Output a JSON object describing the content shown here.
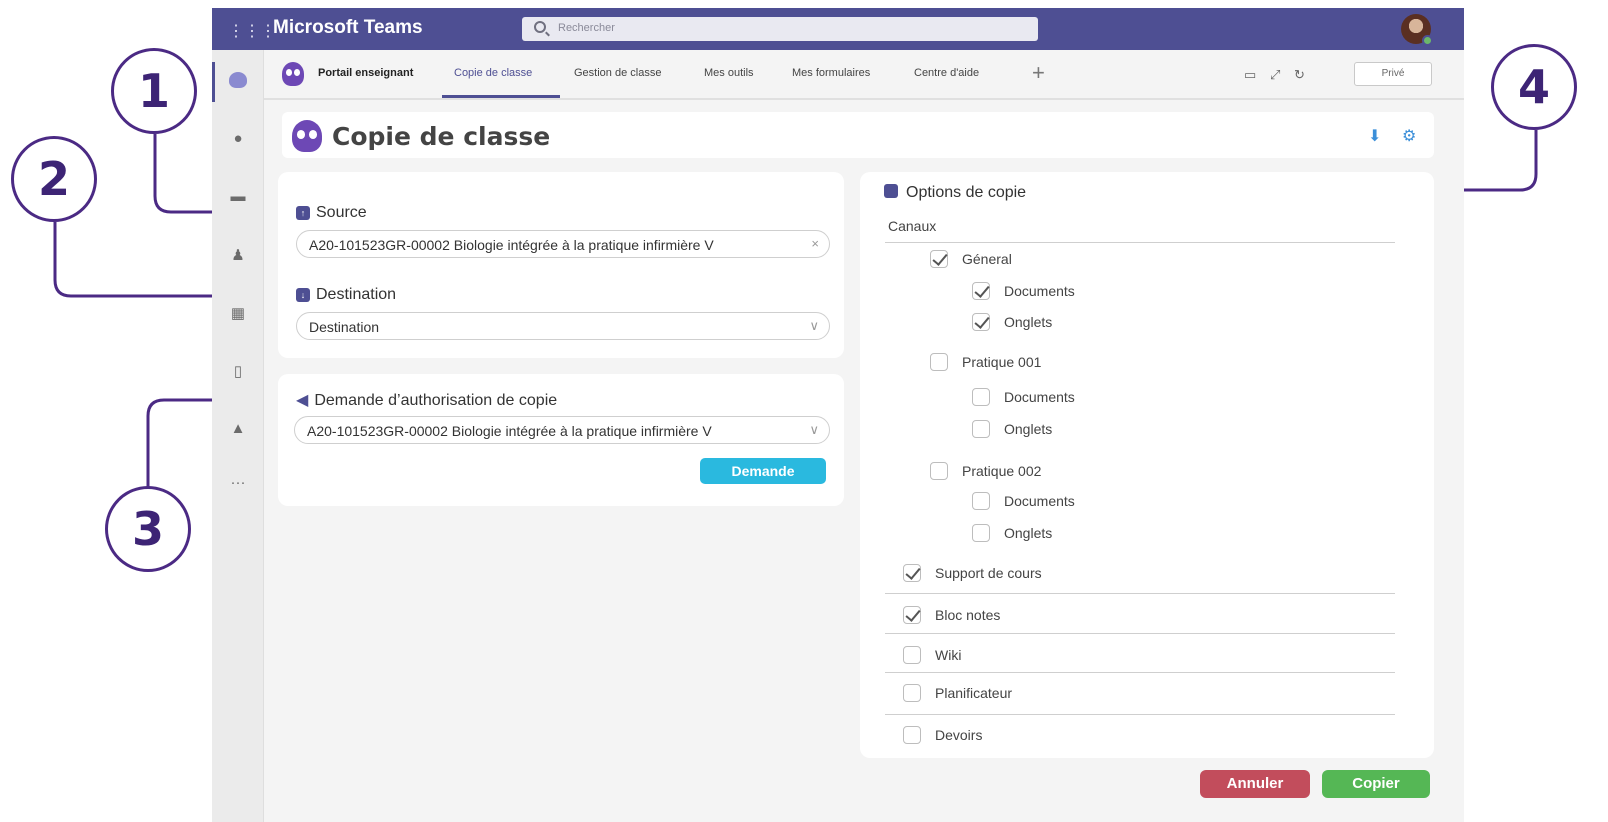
{
  "callouts": [
    "1",
    "2",
    "3",
    "4"
  ],
  "titlebar": {
    "app_name": "Microsoft Teams",
    "search_placeholder": "Rechercher"
  },
  "tabs": [
    {
      "label": "Portail enseignant",
      "active": false
    },
    {
      "label": "Copie de classe",
      "active": true
    },
    {
      "label": "Gestion de classe",
      "active": false
    },
    {
      "label": "Mes outils",
      "active": false
    },
    {
      "label": "Mes formulaires",
      "active": false
    },
    {
      "label": "Centre d'aide",
      "active": false
    }
  ],
  "tabbar": {
    "add_label": "+",
    "private_label": "Privé"
  },
  "page": {
    "title": "Copie de classe"
  },
  "source": {
    "label": "Source",
    "value": "A20-101523GR-00002 Biologie intégrée à la pratique infirmière V",
    "clear": "×"
  },
  "destination": {
    "label": "Destination",
    "value": "Destination"
  },
  "request": {
    "label": "Demande d’authorisation de copie",
    "value": "A20-101523GR-00002 Biologie intégrée à la pratique infirmière V",
    "button": "Demande"
  },
  "options": {
    "title": "Options de copie",
    "channels_header": "Canaux",
    "items": [
      {
        "label": "Géneral",
        "checked": true
      },
      {
        "label": "Documents",
        "checked": true
      },
      {
        "label": "Onglets",
        "checked": true
      },
      {
        "label": "Pratique 001",
        "checked": false
      },
      {
        "label": "Documents",
        "checked": false
      },
      {
        "label": "Onglets",
        "checked": false
      },
      {
        "label": "Pratique 002",
        "checked": false
      },
      {
        "label": "Documents",
        "checked": false
      },
      {
        "label": "Onglets",
        "checked": false
      },
      {
        "label": "Support de cours",
        "checked": true
      },
      {
        "label": "Bloc notes",
        "checked": true
      },
      {
        "label": "Wiki",
        "checked": false
      },
      {
        "label": "Planificateur",
        "checked": false
      },
      {
        "label": "Devoirs",
        "checked": false
      }
    ]
  },
  "footer": {
    "cancel": "Annuler",
    "copy": "Copier"
  },
  "colors": {
    "teams_purple": "#4e4f93",
    "callout": "#4b2a84",
    "request_button": "#2ab9df",
    "cancel": "#c24d5c",
    "copy": "#55b755"
  },
  "icons": [
    "apps-grid-icon",
    "search-icon",
    "bell-icon",
    "chat-icon",
    "teams-icon",
    "calendar-icon",
    "file-icon",
    "store-icon",
    "more-icon",
    "chat-bubble-icon",
    "expand-icon",
    "refresh-icon",
    "download-icon",
    "settings-icon",
    "megaphone-icon"
  ]
}
